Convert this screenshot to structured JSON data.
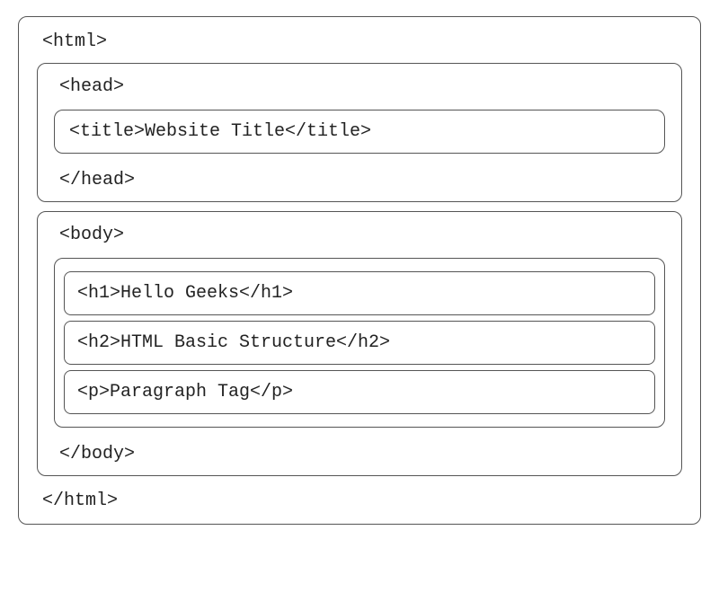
{
  "htmlBox": {
    "open": "<html>",
    "close": "</html>"
  },
  "headBox": {
    "open": "<head>",
    "close": "</head>",
    "title": "<title>Website Title</title>"
  },
  "bodyBox": {
    "open": "<body>",
    "close": "</body>",
    "items": [
      "<h1>Hello Geeks</h1>",
      "<h2>HTML Basic Structure</h2>",
      "<p>Paragraph Tag</p>"
    ]
  }
}
